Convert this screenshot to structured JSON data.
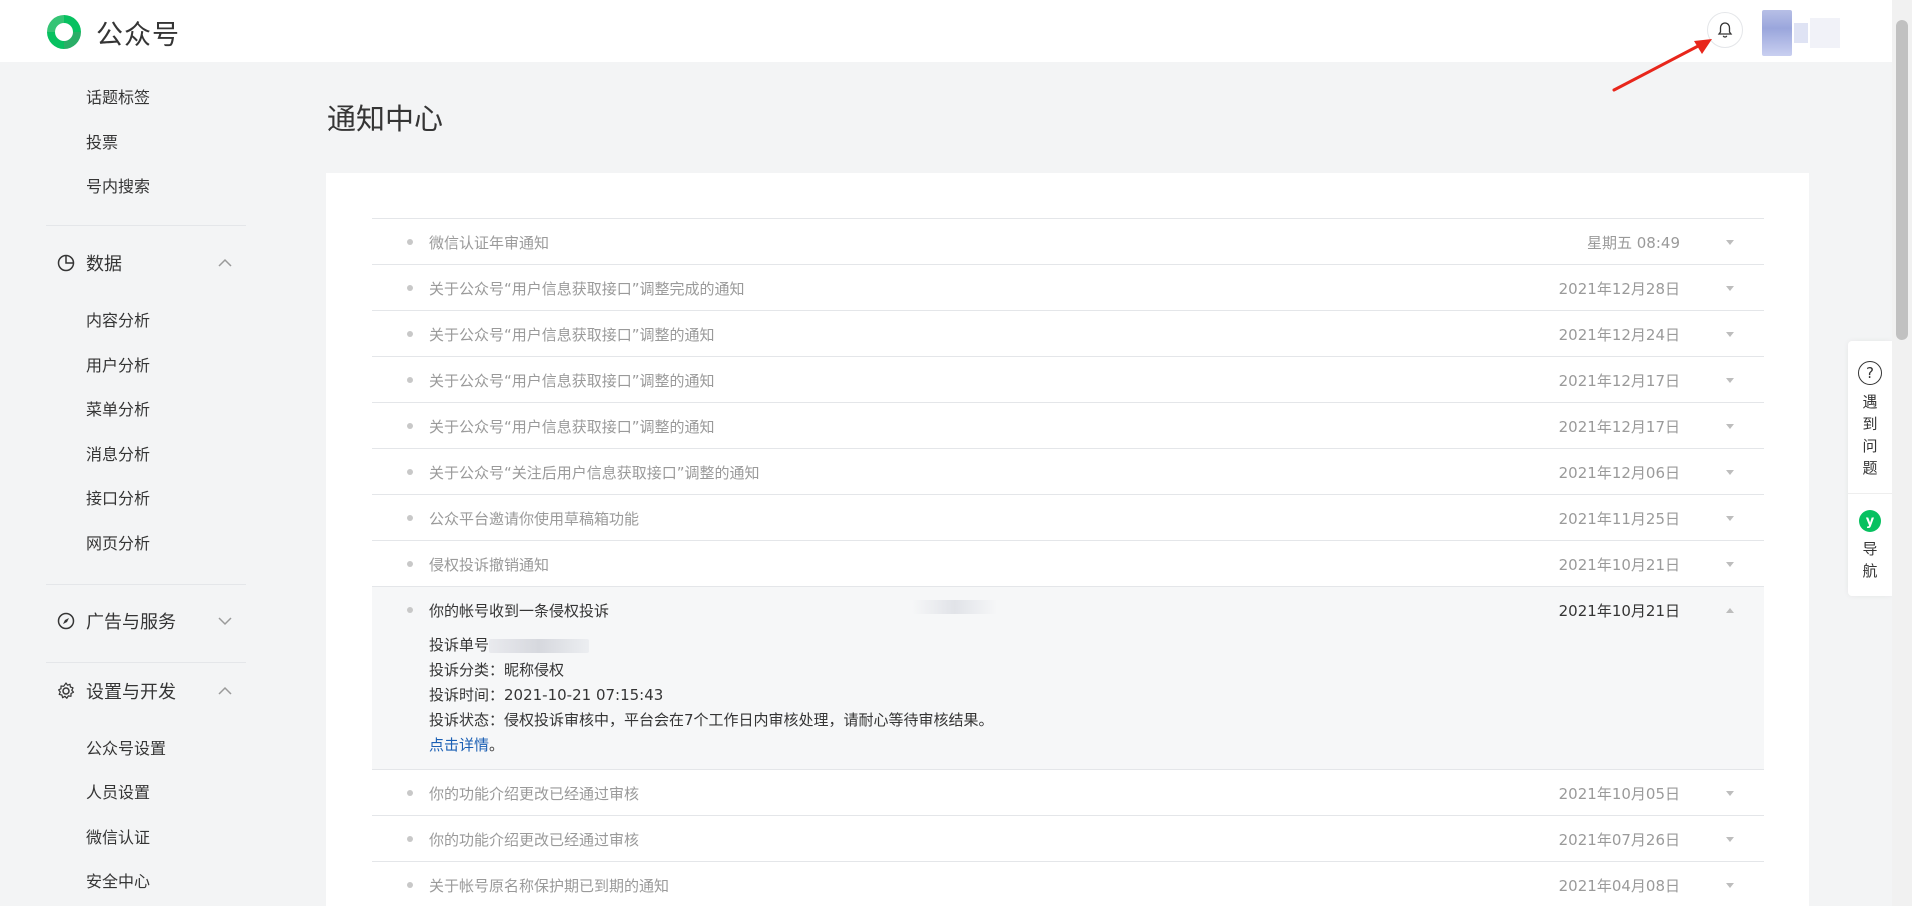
{
  "header": {
    "app_name": "公众号"
  },
  "sidebar": {
    "top_items": [
      {
        "label": "话题标签"
      },
      {
        "label": "投票"
      },
      {
        "label": "号内搜索"
      }
    ],
    "groups": [
      {
        "label": "数据",
        "icon": "chart-pie-icon",
        "expanded": true,
        "items": [
          {
            "label": "内容分析"
          },
          {
            "label": "用户分析"
          },
          {
            "label": "菜单分析"
          },
          {
            "label": "消息分析"
          },
          {
            "label": "接口分析"
          },
          {
            "label": "网页分析"
          }
        ]
      },
      {
        "label": "广告与服务",
        "icon": "compass-icon",
        "expanded": false,
        "items": []
      },
      {
        "label": "设置与开发",
        "icon": "gear-icon",
        "expanded": true,
        "items": [
          {
            "label": "公众号设置"
          },
          {
            "label": "人员设置"
          },
          {
            "label": "微信认证"
          },
          {
            "label": "安全中心"
          }
        ]
      }
    ]
  },
  "main": {
    "title": "通知中心",
    "notifications": [
      {
        "title": "微信认证年审通知",
        "date": "星期五 08:49"
      },
      {
        "title": "关于公众号“用户信息获取接口”调整完成的通知",
        "date": "2021年12月28日"
      },
      {
        "title": "关于公众号“用户信息获取接口”调整的通知",
        "date": "2021年12月24日"
      },
      {
        "title": "关于公众号“用户信息获取接口”调整的通知",
        "date": "2021年12月17日"
      },
      {
        "title": "关于公众号“用户信息获取接口”调整的通知",
        "date": "2021年12月17日"
      },
      {
        "title": "关于公众号“关注后用户信息获取接口”调整的通知",
        "date": "2021年12月06日"
      },
      {
        "title": "公众平台邀请你使用草稿箱功能",
        "date": "2021年11月25日"
      },
      {
        "title": "侵权投诉撤销通知",
        "date": "2021年10月21日"
      },
      {
        "title": "你的帐号收到一条侵权投诉",
        "date": "2021年10月21日"
      },
      {
        "title": "你的功能介绍更改已经通过审核",
        "date": "2021年10月05日"
      },
      {
        "title": "你的功能介绍更改已经通过审核",
        "date": "2021年07月26日"
      },
      {
        "title": "关于帐号原名称保护期已到期的通知",
        "date": "2021年04月08日"
      }
    ],
    "expanded_detail": {
      "complaint_no_label": "投诉单号",
      "category_line": "投诉分类：昵称侵权",
      "time_line": "投诉时间：2021-10-21 07:15:43",
      "status_line": "投诉状态：侵权投诉审核中，平台会在7个工作日内审核处理，请耐心等待审核结果。",
      "link_text": "点击详情",
      "link_suffix": "。"
    }
  },
  "float_panel": {
    "help_label": "遇到问题",
    "help_icon_glyph": "?",
    "nav_label": "导航",
    "nav_icon_glyph": "y"
  },
  "colors": {
    "brand_green": "#07c160",
    "link_blue": "#1a5fb4",
    "arrow_red": "#e8261b"
  }
}
